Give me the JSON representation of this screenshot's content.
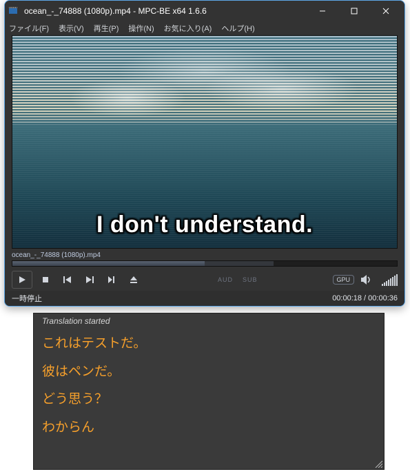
{
  "window": {
    "title": "ocean_-_74888 (1080p).mp4 - MPC-BE x64 1.6.6"
  },
  "menu": {
    "file": "ファイル(F)",
    "view": "表示(V)",
    "play": "再生(P)",
    "nav": "操作(N)",
    "fav": "お気に入り(A)",
    "help": "ヘルプ(H)"
  },
  "video": {
    "subtitle": "I don't understand."
  },
  "seek": {
    "label": "ocean_-_74888 (1080p).mp4"
  },
  "indicators": {
    "aud": "AUD",
    "sub": "SUB",
    "gpu": "GPU"
  },
  "status": {
    "text": "一時停止",
    "time": "00:00:18 / 00:00:36"
  },
  "translation": {
    "header": "Translation started",
    "lines": [
      "これはテストだ。",
      "彼はペンだ。",
      "どう思う？",
      "わからん"
    ]
  }
}
